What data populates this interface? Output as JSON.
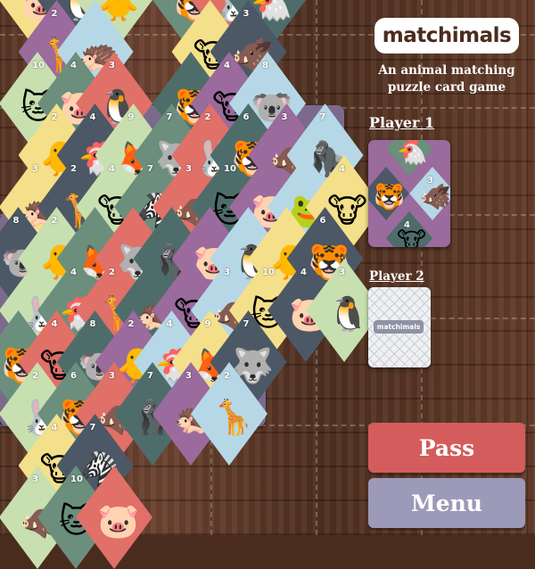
{
  "app": {
    "logo_text": "matchimals",
    "tagline": "An animal matching puzzle card game"
  },
  "players": {
    "player1": {
      "label": "Player 1"
    },
    "player2": {
      "label": "Player 2",
      "card_back_logo": "matchimals"
    }
  },
  "buttons": {
    "pass_label": "Pass",
    "menu_label": "Menu"
  },
  "colors": {
    "pass": "#d45c5c",
    "menu": "#9c9ab8",
    "wood": "#5a3626"
  },
  "tile_colors": [
    "#f4e08a",
    "#6b8f7c",
    "#9a6b9c",
    "#4c5866",
    "#e07068",
    "#b6d8e6",
    "#c8e0b0",
    "#4e6d6a"
  ],
  "board_tiles": [
    {
      "emoji": "🐷",
      "num": ""
    },
    {
      "emoji": "🐧",
      "num": ""
    },
    {
      "emoji": "🐥",
      "num": ""
    },
    {
      "emoji": "🐯",
      "num": "6"
    },
    {
      "emoji": "🐰",
      "num": ""
    },
    {
      "emoji": "🐔",
      "num": "4"
    },
    {
      "emoji": "🦒",
      "num": "2"
    },
    {
      "emoji": "🦔",
      "num": ""
    },
    {
      "emoji": "🐮",
      "num": ""
    },
    {
      "emoji": "🐗",
      "num": "3"
    },
    {
      "emoji": "🐱",
      "num": "10"
    },
    {
      "emoji": "🐷",
      "num": "4"
    },
    {
      "emoji": "🐧",
      "num": "3"
    },
    {
      "emoji": "🐯",
      "num": ""
    },
    {
      "emoji": "🐮",
      "num": "4"
    },
    {
      "emoji": "🐨",
      "num": "8"
    },
    {
      "emoji": "🐥",
      "num": "2"
    },
    {
      "emoji": "🐔",
      "num": "4"
    },
    {
      "emoji": "🦊",
      "num": "9"
    },
    {
      "emoji": "🐺",
      "num": "7"
    },
    {
      "emoji": "🐰",
      "num": "2"
    },
    {
      "emoji": "🐯",
      "num": "6"
    },
    {
      "emoji": "🐗",
      "num": "3"
    },
    {
      "emoji": "🦍",
      "num": "7"
    },
    {
      "emoji": "🦔",
      "num": "3"
    },
    {
      "emoji": "🦒",
      "num": "2"
    },
    {
      "emoji": "🐮",
      "num": "4"
    },
    {
      "emoji": "🦓",
      "num": "7"
    },
    {
      "emoji": "🐗",
      "num": "3"
    },
    {
      "emoji": "🐱",
      "num": "10"
    },
    {
      "emoji": "🐷",
      "num": ""
    },
    {
      "emoji": "🐸",
      "num": ""
    },
    {
      "emoji": "🐮",
      "num": "4"
    },
    {
      "emoji": "🐨",
      "num": "8"
    },
    {
      "emoji": "🐥",
      "num": "2"
    },
    {
      "emoji": "🦊",
      "num": ""
    },
    {
      "emoji": "🐺",
      "num": ""
    },
    {
      "emoji": "🦍",
      "num": ""
    }
  ],
  "hand_card": [
    {
      "emoji": "🐔",
      "num": ""
    },
    {
      "emoji": "🐯",
      "num": ""
    },
    {
      "emoji": "🐗",
      "num": "3"
    },
    {
      "emoji": "🐮",
      "num": "4"
    }
  ]
}
